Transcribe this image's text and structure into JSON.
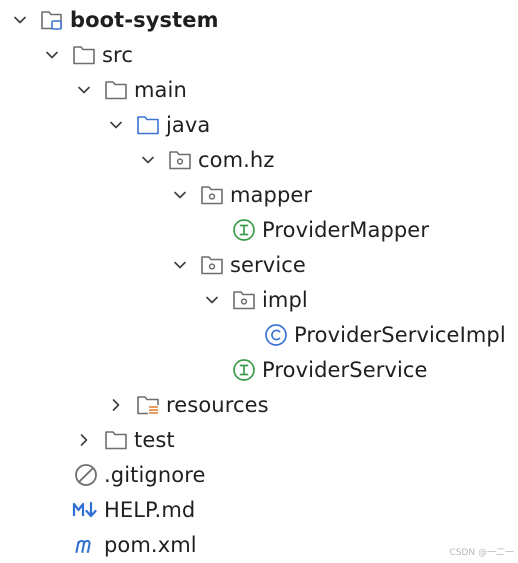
{
  "tree": {
    "project": {
      "label": "boot-system",
      "icon": "project-module-icon",
      "expanded": true
    },
    "src": {
      "label": "src",
      "icon": "folder-icon",
      "expanded": true
    },
    "main": {
      "label": "main",
      "icon": "folder-icon",
      "expanded": true
    },
    "java": {
      "label": "java",
      "icon": "source-folder-icon",
      "expanded": true
    },
    "com_hz": {
      "label": "com.hz",
      "icon": "package-icon",
      "expanded": true
    },
    "mapper": {
      "label": "mapper",
      "icon": "package-icon",
      "expanded": true
    },
    "provider_mapper": {
      "label": "ProviderMapper",
      "icon": "interface-icon"
    },
    "service": {
      "label": "service",
      "icon": "package-icon",
      "expanded": true
    },
    "impl": {
      "label": "impl",
      "icon": "package-icon",
      "expanded": true
    },
    "provider_service_impl": {
      "label": "ProviderServiceImpl",
      "icon": "class-icon"
    },
    "provider_service": {
      "label": "ProviderService",
      "icon": "interface-icon"
    },
    "resources": {
      "label": "resources",
      "icon": "resources-folder-icon",
      "expanded": false
    },
    "test": {
      "label": "test",
      "icon": "folder-icon",
      "expanded": false
    },
    "gitignore": {
      "label": ".gitignore",
      "icon": "ignore-file-icon"
    },
    "help_md": {
      "label": "HELP.md",
      "icon": "markdown-file-icon"
    },
    "pom_xml": {
      "label": "pom.xml",
      "icon": "maven-file-icon"
    }
  },
  "watermark": "CSDN @一二一",
  "colors": {
    "interface_green": "#3c9c4c",
    "class_blue": "#3b74d6",
    "source_folder_blue": "#3b74d6",
    "folder_gray": "#6e6e6e",
    "resources_orange": "#e0782a",
    "markdown_blue": "#2f6fd1"
  }
}
